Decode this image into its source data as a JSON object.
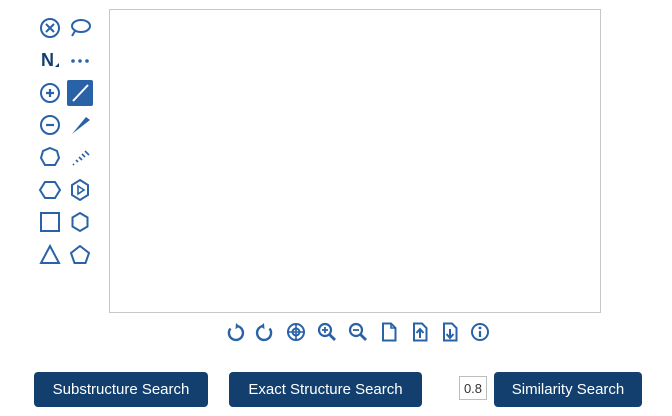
{
  "colors": {
    "icon": "#2a62a8",
    "button_bg": "#123f6e",
    "button_text": "#ffffff"
  },
  "left_toolbar": [
    {
      "name": "clear-icon",
      "semantic": "clear"
    },
    {
      "name": "lasso-icon",
      "semantic": "lasso-select"
    },
    {
      "name": "atom-n-icon",
      "semantic": "atom",
      "label": "N"
    },
    {
      "name": "chain-icon",
      "semantic": "chain"
    },
    {
      "name": "charge-plus-icon",
      "semantic": "increase-charge"
    },
    {
      "name": "single-bond-icon",
      "semantic": "single-bond",
      "active": true
    },
    {
      "name": "charge-minus-icon",
      "semantic": "decrease-charge"
    },
    {
      "name": "wedge-bond-icon",
      "semantic": "wedge-bond"
    },
    {
      "name": "cycloheptane-icon",
      "semantic": "ring-7"
    },
    {
      "name": "hash-bond-icon",
      "semantic": "hash-bond"
    },
    {
      "name": "cyclohexane-icon",
      "semantic": "ring-6"
    },
    {
      "name": "benzene-icon",
      "semantic": "benzene"
    },
    {
      "name": "cyclobutane-icon",
      "semantic": "ring-4"
    },
    {
      "name": "hexagon-icon",
      "semantic": "ring-6-flat"
    },
    {
      "name": "cyclopropane-icon",
      "semantic": "ring-3"
    },
    {
      "name": "cyclopentane-icon",
      "semantic": "ring-5"
    }
  ],
  "bottom_toolbar": [
    {
      "name": "undo-icon"
    },
    {
      "name": "redo-icon"
    },
    {
      "name": "center-icon"
    },
    {
      "name": "zoom-in-icon"
    },
    {
      "name": "zoom-out-icon"
    },
    {
      "name": "new-document-icon"
    },
    {
      "name": "upload-icon"
    },
    {
      "name": "download-icon"
    },
    {
      "name": "info-icon"
    }
  ],
  "buttons": {
    "substructure": "Substructure Search",
    "exact": "Exact Structure Search",
    "similarity": "Similarity Search"
  },
  "similarity_threshold": {
    "value": "0.8"
  }
}
